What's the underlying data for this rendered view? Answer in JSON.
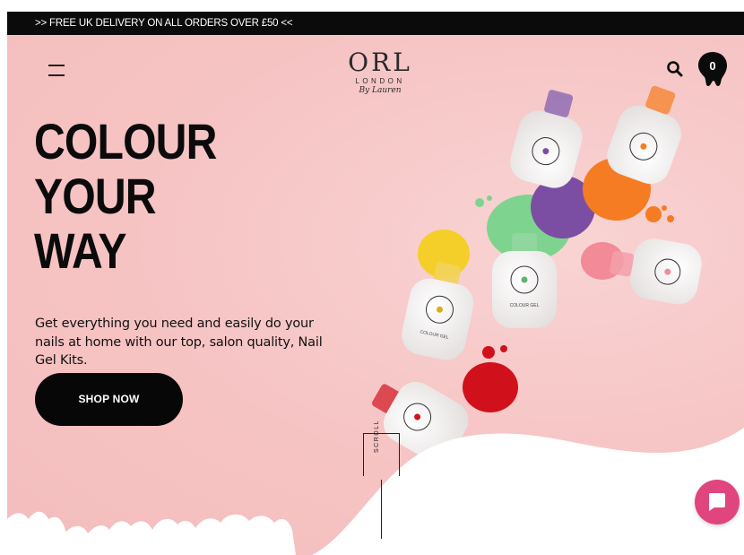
{
  "promo": {
    "text": ">> FREE UK DELIVERY ON ALL ORDERS OVER £50 <<"
  },
  "header": {
    "logo_mark": "ORL",
    "logo_sub": "LONDON",
    "logo_script": "By Lauren",
    "cart_count": "0",
    "icons": [
      "menu-icon",
      "search-icon",
      "cart-icon"
    ]
  },
  "hero": {
    "headline": [
      "COLOUR",
      "YOUR",
      "WAY"
    ],
    "subtext": "Get everything you need and easily do your nails at home with our top, salon quality, Nail Gel Kits.",
    "cta_label": "SHOP NOW",
    "scroll_label": "SCROLL",
    "bottle_label": "COLOUR GEL"
  },
  "colors": {
    "background": "#f7c6c6",
    "text": "#0b0b0b",
    "button": "#070707",
    "chat": "#e0457e",
    "polish": [
      "#7b4ea3",
      "#f57c22",
      "#7ed48e",
      "#f4cf2a",
      "#f28a97",
      "#d0111b"
    ]
  },
  "chat": {
    "icon": "chat-bubble-icon"
  }
}
